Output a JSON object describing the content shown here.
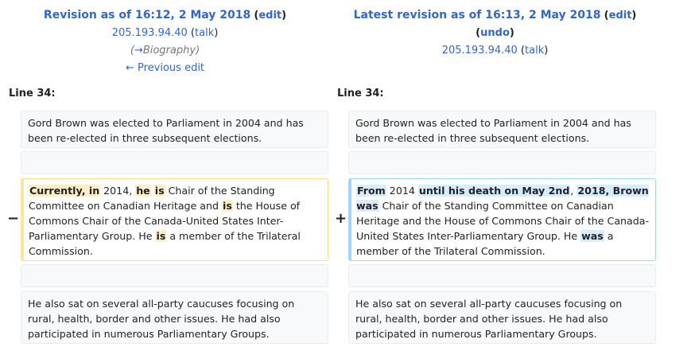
{
  "left_header": {
    "title": "Revision as of 16:12, 2 May 2018",
    "edit": "edit",
    "user": "205.193.94.40",
    "talk": "talk",
    "comment_arrow": "→",
    "comment_section": "Biography",
    "prev": "← Previous edit"
  },
  "right_header": {
    "title": "Latest revision as of 16:13, 2 May 2018",
    "edit": "edit",
    "undo": "undo",
    "user": "205.193.94.40",
    "talk": "talk"
  },
  "line_label_left": "Line 34:",
  "line_label_right": "Line 34:",
  "markers": {
    "minus": "−",
    "plus": "+"
  },
  "context_1": "Gord Brown was elected to Parliament in 2004 and has been re-elected in three subsequent elections.",
  "context_3": "He also sat on several all-party caucuses focusing on rural, health, border and other issues. He had also participated in numerous Parliamentary Groups.",
  "deleted_line": [
    {
      "t": "Currently, in",
      "hl": true
    },
    {
      "t": " 2014, ",
      "hl": false
    },
    {
      "t": "he",
      "hl": true
    },
    {
      "t": " ",
      "hl": false
    },
    {
      "t": "is",
      "hl": true
    },
    {
      "t": " Chair of the Standing Committee on Canadian Heritage and ",
      "hl": false
    },
    {
      "t": "is",
      "hl": true
    },
    {
      "t": " the House of Commons Chair of the Canada-United States Inter-Parliamentary Group. He ",
      "hl": false
    },
    {
      "t": "is",
      "hl": true
    },
    {
      "t": " a member of the Trilateral Commission.",
      "hl": false
    }
  ],
  "added_line": [
    {
      "t": "From",
      "hl": true
    },
    {
      "t": " 2014 ",
      "hl": false
    },
    {
      "t": "until his death on May 2nd",
      "hl": true
    },
    {
      "t": ", ",
      "hl": false
    },
    {
      "t": "2018, Brown was",
      "hl": true
    },
    {
      "t": " Chair of the Standing Committee on Canadian Heritage and the House of Commons Chair of the Canada-United States Inter-Parliamentary Group. He ",
      "hl": false
    },
    {
      "t": "was",
      "hl": true
    },
    {
      "t": " a member of the Trilateral Commission.",
      "hl": false
    }
  ]
}
